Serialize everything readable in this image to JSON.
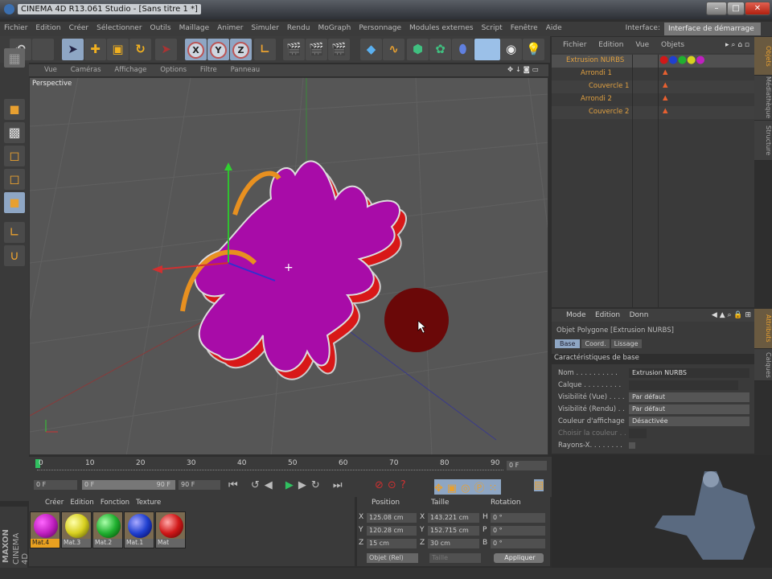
{
  "window": {
    "title": "CINEMA 4D R13.061 Studio - [Sans titre 1 *]",
    "minimize": "–",
    "maximize": "□",
    "close": "✕"
  },
  "menu": [
    "Fichier",
    "Edition",
    "Créer",
    "Sélectionner",
    "Outils",
    "Maillage",
    "Animer",
    "Simuler",
    "Rendu",
    "MoGraph",
    "Personnage",
    "Modules externes",
    "Script",
    "Fenêtre",
    "Aide"
  ],
  "interface": {
    "label": "Interface:",
    "value": "Interface de démarrage"
  },
  "toolbar": {
    "x": "X",
    "y": "Y",
    "z": "Z"
  },
  "viewport": {
    "menu": [
      "Vue",
      "Caméras",
      "Affichage",
      "Options",
      "Filtre",
      "Panneau"
    ],
    "name": "Perspective"
  },
  "objects": {
    "menu": [
      "Fichier",
      "Edition",
      "Vue",
      "Objets"
    ],
    "items": [
      {
        "name": "Extrusion NURBS"
      },
      {
        "name": "Arrondi 1"
      },
      {
        "name": "Couvercle 1"
      },
      {
        "name": "Arrondi 2"
      },
      {
        "name": "Couvercle 2"
      }
    ],
    "tabs": [
      "Objets",
      "Médiathèque",
      "Structure"
    ]
  },
  "attributes": {
    "menu": [
      "Mode",
      "Edition",
      "Donn"
    ],
    "title": "Objet Polygone [Extrusion NURBS]",
    "tabs": [
      "Base",
      "Coord.",
      "Lissage"
    ],
    "section": "Caractéristiques de base",
    "fields": [
      {
        "label": "Nom . . . . . . . . . .",
        "value": "Extrusion NURBS"
      },
      {
        "label": "Calque . . . . . . . . .",
        "value": ""
      },
      {
        "label": "Visibilité (Vue) . . . .",
        "value": "Par défaut"
      },
      {
        "label": "Visibilité (Rendu) . .",
        "value": "Par défaut"
      },
      {
        "label": "Couleur d'affichage",
        "value": "Désactivée"
      },
      {
        "label": "Choisir la couleur . .",
        "value": ""
      },
      {
        "label": "Rayons-X. . . . . . . .",
        "value": ""
      }
    ],
    "tabs_side": [
      "Attributs",
      "Calques"
    ]
  },
  "timeline": {
    "ticks": [
      "0",
      "10",
      "20",
      "30",
      "40",
      "50",
      "60",
      "70",
      "80",
      "90"
    ],
    "current": "0 F",
    "start": "0 F",
    "range_start": "0 F",
    "range_end": "90 F",
    "end": "90 F"
  },
  "materials": {
    "menu": [
      "Créer",
      "Edition",
      "Fonction",
      "Texture"
    ],
    "items": [
      {
        "name": "Mat.4",
        "color": "#c020c0"
      },
      {
        "name": "Mat.3",
        "color": "#d8d020"
      },
      {
        "name": "Mat.2",
        "color": "#20b030"
      },
      {
        "name": "Mat.1",
        "color": "#2040d0"
      },
      {
        "name": "Mat",
        "color": "#d01818"
      }
    ]
  },
  "coords": {
    "headers": [
      "Position",
      "Taille",
      "Rotation"
    ],
    "rows": [
      [
        "X",
        "125.08 cm",
        "X",
        "143.221 cm",
        "H",
        "0 °"
      ],
      [
        "Y",
        "120.28 cm",
        "Y",
        "152.715 cm",
        "P",
        "0 °"
      ],
      [
        "Z",
        "15 cm",
        "Z",
        "30 cm",
        "B",
        "0 °"
      ]
    ],
    "mode": "Objet (Rel)",
    "size_mode": "Taille",
    "apply": "Appliquer"
  },
  "brand": {
    "maxon": "MAXON",
    "cinema": "CINEMA 4D"
  }
}
